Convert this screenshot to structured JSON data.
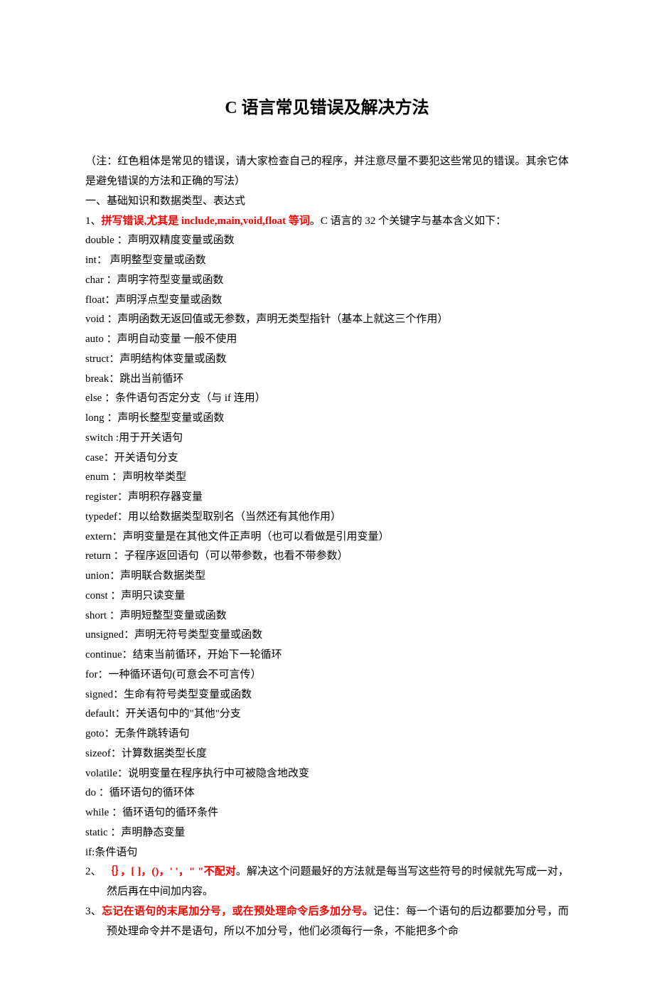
{
  "title": "C 语言常见错误及解决方法",
  "intro": "（注：红色粗体是常见的错误，请大家检查自己的程序，并注意尽量不要犯这些常见的错误。其余它体是避免错误的方法和正确的写法）",
  "sec1": "一、基础知识和数据类型、表达式",
  "item1_prefix": "1、",
  "item1_red": "拼写错误,尤其是 include,main,void,float 等词",
  "item1_suffix": "。C 语言的 32 个关键字与基本含义如下：",
  "kw": [
    "double ：声明双精度变量或函数",
    "int：  声明整型变量或函数",
    "char ：声明字符型变量或函数",
    "float：声明浮点型变量或函数",
    "void ：声明函数无返回值或无参数，声明无类型指针（基本上就这三个作用）",
    "auto ：声明自动变量  一般不使用",
    "struct：声明结构体变量或函数",
    "break：跳出当前循环",
    "else ：条件语句否定分支（与  if  连用）",
    "long ：声明长整型变量或函数",
    "switch :用于开关语句",
    "case：开关语句分支",
    "enum ：声明枚举类型",
    "register：声明积存器变量",
    "typedef：用以给数据类型取别名（当然还有其他作用）",
    "extern：声明变量是在其他文件正声明（也可以看做是引用变量）",
    "return ：子程序返回语句（可以带参数，也看不带参数）",
    "union：声明联合数据类型",
    "const ：声明只读变量",
    "short ：声明短整型变量或函数",
    "unsigned：声明无符号类型变量或函数",
    "continue：结束当前循环，开始下一轮循环",
    "for：一种循环语句(可意会不可言传）",
    "signed：生命有符号类型变量或函数",
    "default：开关语句中的\"其他\"分支",
    "goto：无条件跳转语句",
    "sizeof：计算数据类型长度",
    "volatile：说明变量在程序执行中可被隐含地改变",
    "do ：循环语句的循环体",
    "while ：循环语句的循环条件",
    "static ：声明静态变量",
    "if:条件语句"
  ],
  "item2_prefix": "2、 ",
  "item2_red": "｛｝，[ ]，()，' '，\" \"不配对",
  "item2_suffix": "。解决这个问题最好的方法就是每当写这些符号的时候就先写成一对，然后再在中间加内容。",
  "item3_prefix": "3、",
  "item3_red": "忘记在语句的末尾加分号，或在预处理命令后多加分号。",
  "item3_suffix": "记住：每一个语句的后边都要加分号，而预处理命令并不是语句，所以不加分号，他们必须每行一条，不能把多个命"
}
